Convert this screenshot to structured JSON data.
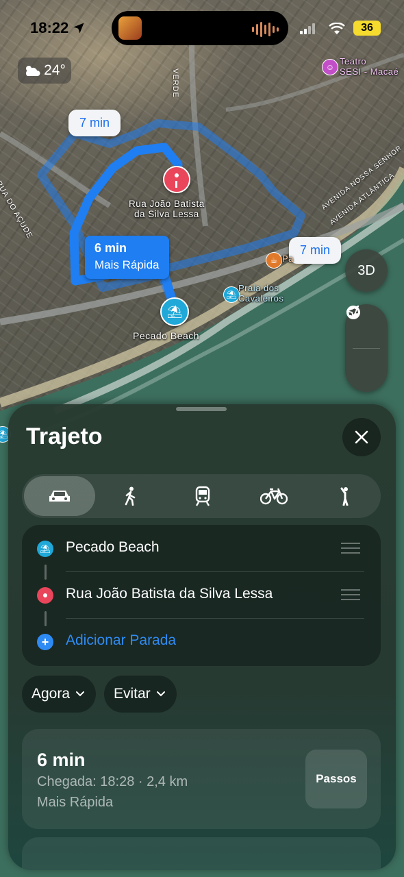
{
  "status_bar": {
    "time": "18:22",
    "battery": "36"
  },
  "weather": {
    "temperature": "24°"
  },
  "map": {
    "time_bubbles": [
      "7 min",
      "7 min"
    ],
    "main_route": {
      "time": "6 min",
      "label": "Mais Rápida"
    },
    "destination_label": "Rua João Batista\nda Silva Lessa",
    "origin_label": "Pecado Beach",
    "poi_praia": "Praia dos\nCavaleiros",
    "poi_teatro": "Teatro\nSESI - Macaé",
    "poi_pa": "Pa",
    "streets": {
      "verde": "VERDE",
      "acude": "RUA DO AÇUDE",
      "avenida1": "AVENIDA NOSSA SENHOR",
      "avenida2": "AVENIDA ATLÂNTICA"
    },
    "btn_3d": "3D"
  },
  "sheet": {
    "title": "Trajeto",
    "stops": [
      {
        "label": "Pecado Beach"
      },
      {
        "label": "Rua João Batista da Silva Lessa"
      }
    ],
    "add_stop": "Adicionar Parada",
    "time_filter": "Agora",
    "avoid_filter": "Evitar",
    "route": {
      "duration": "6 min",
      "details": "Chegada: 18:28 · 2,4 km",
      "tag": "Mais Rápida",
      "steps_label": "Passos"
    }
  },
  "colors": {
    "route_blue": "#1f7ef1",
    "accent_blue": "#2f8bf4",
    "pin_red": "#e9465b",
    "beach_blue": "#1fa8d8",
    "battery_yellow": "#f5db2e"
  }
}
